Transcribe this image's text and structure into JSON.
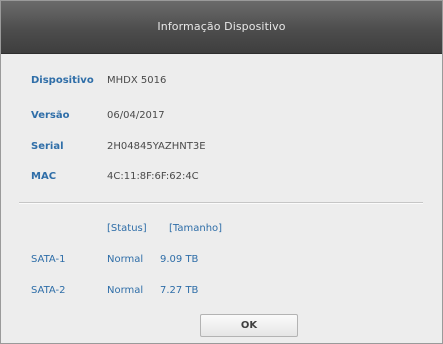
{
  "window": {
    "title": "Informação Dispositivo"
  },
  "device_info": [
    {
      "label": "Dispositivo",
      "value": "MHDX 5016"
    },
    {
      "label": "Versão",
      "value": "06/04/2017"
    },
    {
      "label": "Serial",
      "value": "2H04845YAZHNT3E"
    },
    {
      "label": "MAC",
      "value": "4C:11:8F:6F:62:4C"
    }
  ],
  "disks": {
    "header_status": "[Status]",
    "header_size": "[Tamanho]",
    "rows": [
      {
        "name": "SATA-1",
        "status": "Normal",
        "size": "9.09 TB"
      },
      {
        "name": "SATA-2",
        "status": "Normal",
        "size": "7.27 TB"
      }
    ]
  },
  "buttons": {
    "ok_label": "OK"
  },
  "colors": {
    "titlebar": "#4d4d4d",
    "label_blue": "#2f6ea8",
    "background": "#ededed"
  }
}
